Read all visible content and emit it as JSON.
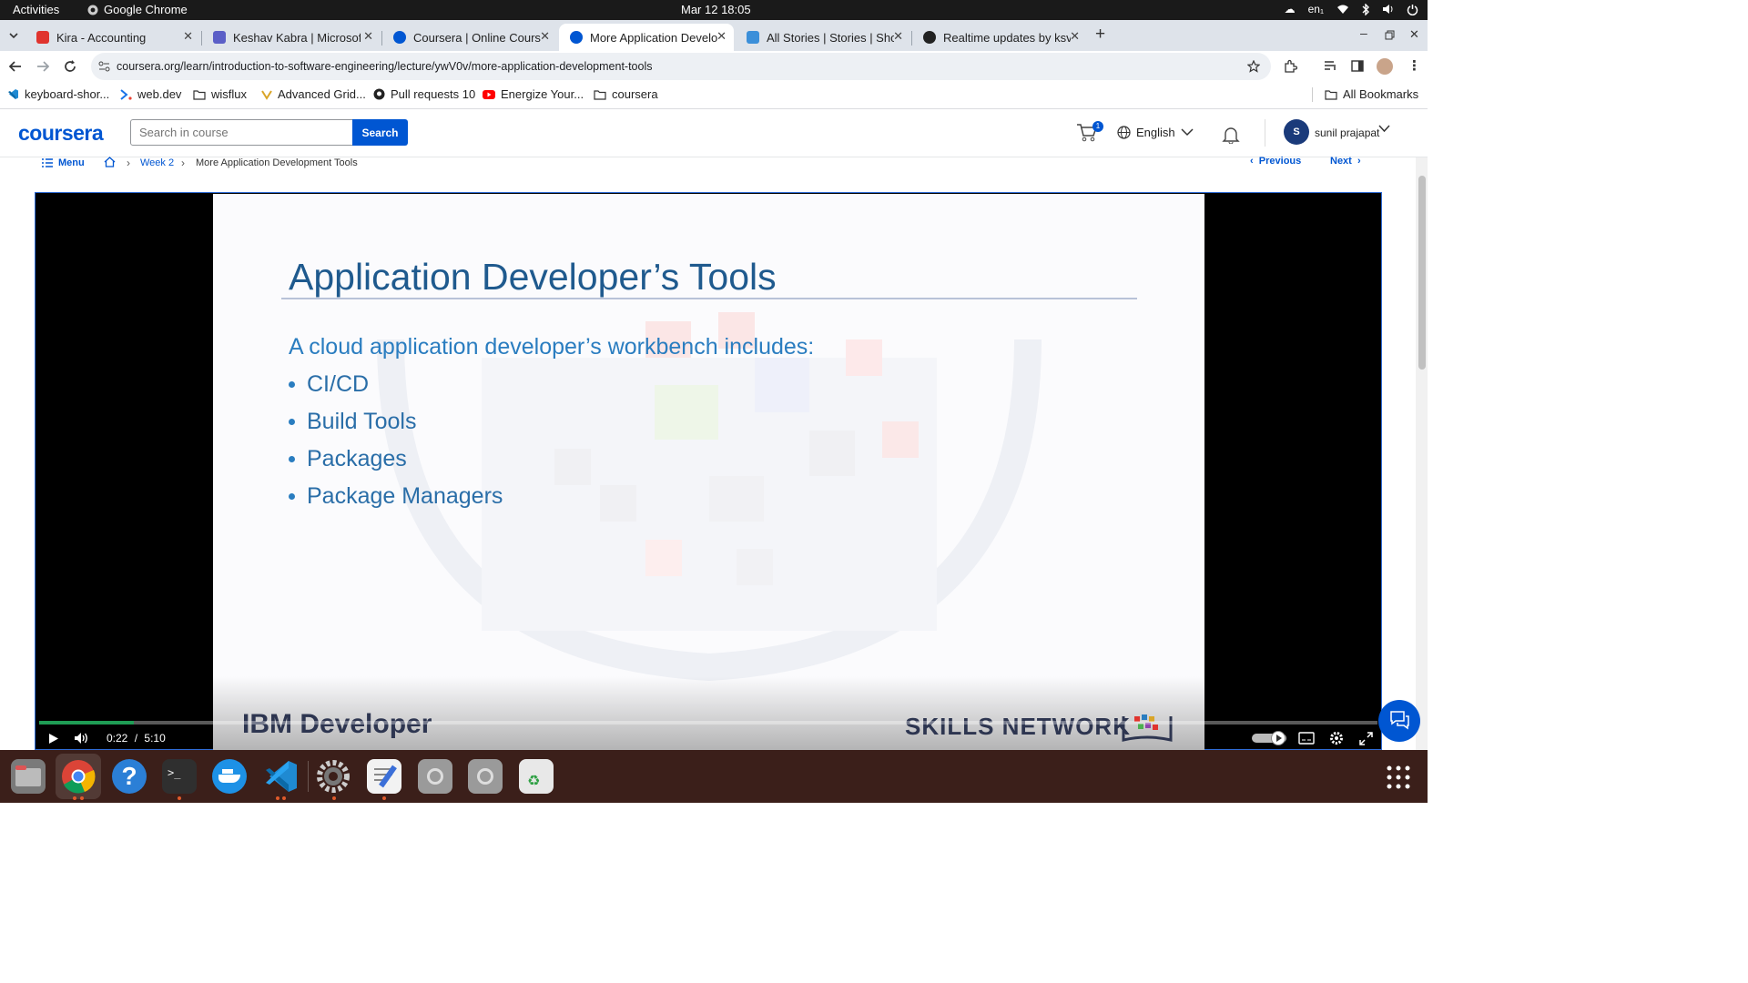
{
  "topbar": {
    "activities": "Activities",
    "app_name": "Google Chrome",
    "clock": "Mar 12  18:05",
    "input_lang": "en₁"
  },
  "tabs": [
    {
      "title": "Kira - Accounting",
      "color": "#e0342e"
    },
    {
      "title": "Keshav Kabra | Microsoft",
      "color": "#5b5fc7"
    },
    {
      "title": "Coursera | Online Courses",
      "color": "#0056d2"
    },
    {
      "title": "More Application Develop",
      "color": "#0056d2"
    },
    {
      "title": "All Stories | Stories | Sho",
      "color": "#3b8fd9"
    },
    {
      "title": "Realtime updates by ksv",
      "color": "#222222"
    }
  ],
  "toolbar": {
    "url": "coursera.org/learn/introduction-to-software-engineering/lecture/ywV0v/more-application-development-tools"
  },
  "bookmarks": [
    {
      "label": "keyboard-shor...",
      "icon": "vscode-icon"
    },
    {
      "label": "web.dev",
      "icon": "webdev-icon"
    },
    {
      "label": "wisflux",
      "icon": "folder-icon"
    },
    {
      "label": "Advanced Grid...",
      "icon": "grid-icon"
    },
    {
      "label": "Pull requests 10",
      "icon": "github-icon"
    },
    {
      "label": "Energize Your...",
      "icon": "youtube-icon"
    },
    {
      "label": "coursera",
      "icon": "folder-icon"
    }
  ],
  "all_bookmarks": "All Bookmarks",
  "coursera": {
    "logo": "coursera",
    "search_placeholder": "Search in course",
    "search_button": "Search",
    "cart_count": "1",
    "language": "English",
    "avatar_initial": "S",
    "user_name": "sunil prajapat",
    "accent": "#0056d2"
  },
  "breadcrumb": {
    "menu": "Menu",
    "week": "Week 2",
    "current": "More Application Development Tools",
    "previous": "Previous",
    "next": "Next"
  },
  "slide": {
    "title": "Application Developer’s Tools",
    "subtitle": "A cloud application developer’s workbench includes:",
    "bullets": [
      "CI/CD",
      "Build Tools",
      "Packages",
      "Package Managers"
    ],
    "footer_left": "IBM Developer",
    "footer_right": "SKILLS NETWORK"
  },
  "player": {
    "current_time": "0:22",
    "separator": "/",
    "duration": "5:10",
    "progress_fraction": 0.071
  }
}
